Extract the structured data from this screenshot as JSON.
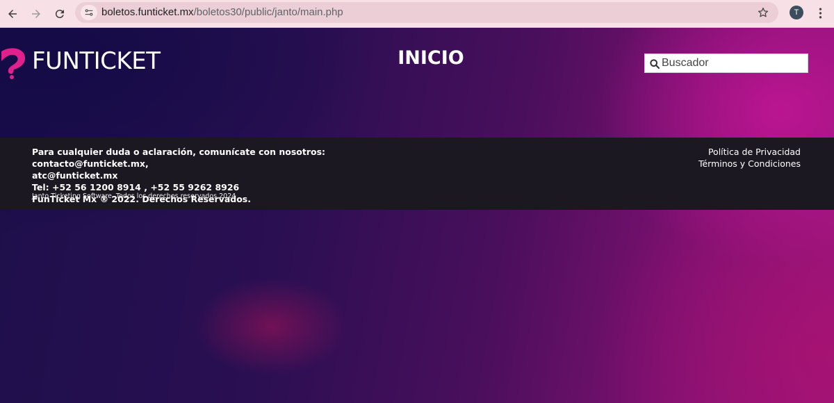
{
  "browser": {
    "url_domain": "boletos.funticket.mx",
    "url_path": "/boletos30/public/janto/main.php",
    "profile_initial": "T",
    "icons": [
      "back-icon",
      "forward-icon",
      "reload-icon",
      "site-info-icon",
      "bookmark-star-icon",
      "menu-dots-icon"
    ]
  },
  "header": {
    "logo_text": "FUNTICKET",
    "title": "INICIO",
    "search_placeholder": "Buscador"
  },
  "footer": {
    "contact_line1": "Para cualquier duda o aclaración, comunícate con nosotros: contacto@funticket.mx,",
    "contact_line2": "atc@funticket.mx",
    "phone_line": "Tel: +52 56 1200 8914 , +52 55 9262 8926",
    "copyright": "FunTicket Mx ® 2022. Derechos Reservados.",
    "software": "Janto Ticketing Software. Todos los derechos reservados,2024",
    "links": [
      "Política de Privacidad",
      "Términos y Condiciones"
    ]
  },
  "colors": {
    "chrome_bg": "#f7e1e6",
    "footer_bg": "#1c1822",
    "logo_accent": "#e0208c"
  }
}
